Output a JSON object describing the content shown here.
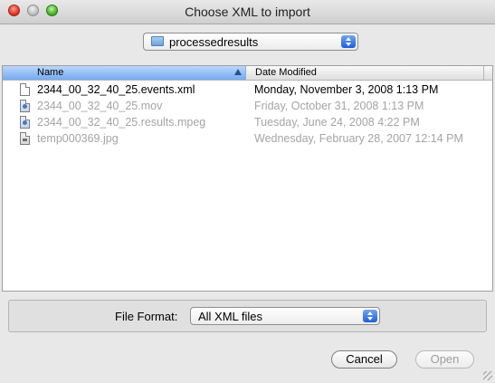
{
  "window": {
    "title": "Choose XML to import"
  },
  "location": {
    "folder": "processedresults"
  },
  "columns": {
    "name": "Name",
    "date": "Date Modified"
  },
  "files": [
    {
      "name": "2344_00_32_40_25.events.xml",
      "date": "Monday, November 3, 2008 1:13 PM",
      "icon": "xml-document-icon",
      "enabled": true
    },
    {
      "name": "2344_00_32_40_25.mov",
      "date": "Friday, October 31, 2008 1:13 PM",
      "icon": "movie-file-icon",
      "enabled": false
    },
    {
      "name": "2344_00_32_40_25.results.mpeg",
      "date": "Tuesday, June 24, 2008 4:22 PM",
      "icon": "mpeg-file-icon",
      "enabled": false
    },
    {
      "name": "temp000369.jpg",
      "date": "Wednesday, February 28, 2007 12:14 PM",
      "icon": "image-file-icon",
      "enabled": false
    }
  ],
  "format": {
    "label": "File Format:",
    "selected": "All XML files"
  },
  "buttons": {
    "cancel": "Cancel",
    "open": "Open"
  }
}
